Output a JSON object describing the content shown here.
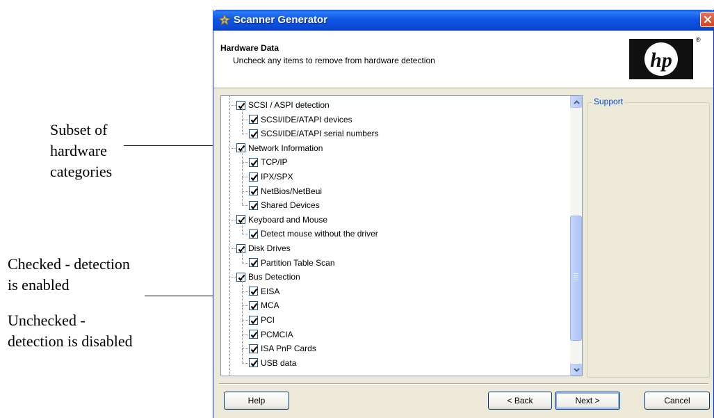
{
  "annotations": {
    "subset": "Subset of\nhardware\ncategories",
    "checked": "Checked - detection\nis enabled",
    "unchecked": "Unchecked -\ndetection is disabled"
  },
  "window": {
    "title": "Scanner Generator",
    "titlebar_color": "#0a49d6"
  },
  "header": {
    "title": "Hardware Data",
    "subtitle": "Uncheck any items to remove from hardware detection",
    "logo": "hp"
  },
  "tree": {
    "items": [
      {
        "label": "SCSI / ASPI detection",
        "checked": true,
        "level": 0
      },
      {
        "label": "SCSI/IDE/ATAPI devices",
        "checked": true,
        "level": 1
      },
      {
        "label": "SCSI/IDE/ATAPI serial numbers",
        "checked": true,
        "level": 1
      },
      {
        "label": "Network Information",
        "checked": true,
        "level": 0
      },
      {
        "label": "TCP/IP",
        "checked": true,
        "level": 1
      },
      {
        "label": "IPX/SPX",
        "checked": true,
        "level": 1
      },
      {
        "label": "NetBios/NetBeui",
        "checked": true,
        "level": 1
      },
      {
        "label": "Shared Devices",
        "checked": true,
        "level": 1
      },
      {
        "label": "Keyboard and Mouse",
        "checked": true,
        "level": 0
      },
      {
        "label": "Detect mouse without the driver",
        "checked": true,
        "level": 1
      },
      {
        "label": "Disk Drives",
        "checked": true,
        "level": 0
      },
      {
        "label": "Partition Table Scan",
        "checked": true,
        "level": 1
      },
      {
        "label": "Bus Detection",
        "checked": true,
        "level": 0
      },
      {
        "label": "EISA",
        "checked": true,
        "level": 1
      },
      {
        "label": "MCA",
        "checked": true,
        "level": 1
      },
      {
        "label": "PCI",
        "checked": true,
        "level": 1
      },
      {
        "label": "PCMCIA",
        "checked": true,
        "level": 1
      },
      {
        "label": "ISA PnP Cards",
        "checked": true,
        "level": 1
      },
      {
        "label": "USB data",
        "checked": true,
        "level": 1
      }
    ]
  },
  "support": {
    "label": "Support"
  },
  "buttons": {
    "help": "Help",
    "back": "< Back",
    "next": "Next >",
    "cancel": "Cancel"
  },
  "colors": {
    "accent": "#0a49d6",
    "support_label": "#0046d5"
  }
}
